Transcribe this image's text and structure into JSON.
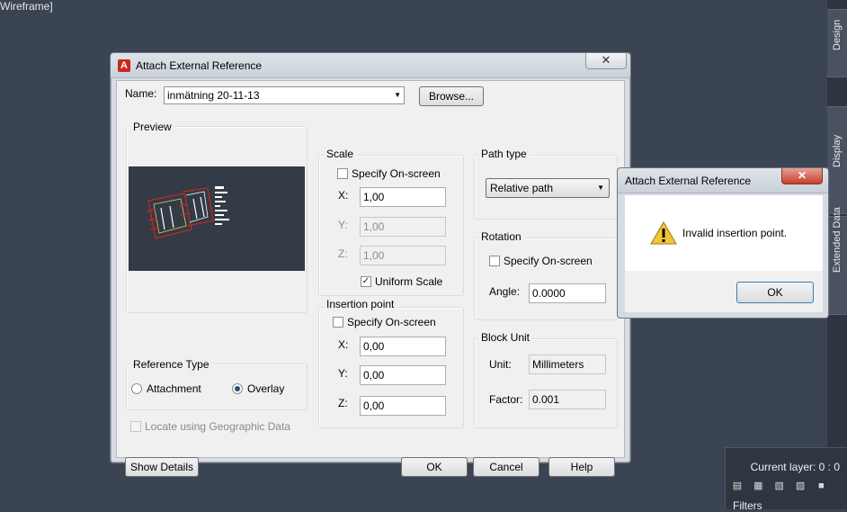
{
  "viewport": {
    "label": "Wireframe]"
  },
  "side_tabs": [
    "Design",
    "Display",
    "Extended Data"
  ],
  "layer_panel": {
    "current_layer": "Current layer: 0 : 0",
    "filters": "Filters"
  },
  "dialog": {
    "title": "Attach External Reference",
    "close_glyph": "✕",
    "name_label": "Name:",
    "name_value": "inmätning 20-11-13",
    "browse_label": "Browse...",
    "preview_title": "Preview",
    "scale": {
      "title": "Scale",
      "specify_label": "Specify On-screen",
      "specify_checked": false,
      "x_label": "X:",
      "x_value": "1,00",
      "y_label": "Y:",
      "y_value": "1,00",
      "z_label": "Z:",
      "z_value": "1,00",
      "uniform_label": "Uniform Scale",
      "uniform_checked": true
    },
    "insertion": {
      "title": "Insertion point",
      "specify_label": "Specify On-screen",
      "specify_checked": false,
      "x_label": "X:",
      "x_value": "0,00",
      "y_label": "Y:",
      "y_value": "0,00",
      "z_label": "Z:",
      "z_value": "0,00"
    },
    "path_type": {
      "title": "Path type",
      "value": "Relative path"
    },
    "rotation": {
      "title": "Rotation",
      "specify_label": "Specify On-screen",
      "angle_label": "Angle:",
      "angle_value": "0.0000"
    },
    "block_unit": {
      "title": "Block Unit",
      "unit_label": "Unit:",
      "unit_value": "Millimeters",
      "factor_label": "Factor:",
      "factor_value": "0.001"
    },
    "reference_type": {
      "title": "Reference Type",
      "attachment_label": "Attachment",
      "overlay_label": "Overlay",
      "selected": "Overlay"
    },
    "geo_label": "Locate using Geographic Data",
    "buttons": {
      "details": "Show Details",
      "ok": "OK",
      "cancel": "Cancel",
      "help": "Help"
    }
  },
  "alert": {
    "title": "Attach External Reference",
    "close_glyph": "✕",
    "message": "Invalid insertion point.",
    "ok": "OK"
  },
  "colors": {
    "app_background": "#3b4453",
    "preview_background": "#323b46",
    "drawing_red": "#c8281e",
    "close_red": "#c7402b"
  }
}
